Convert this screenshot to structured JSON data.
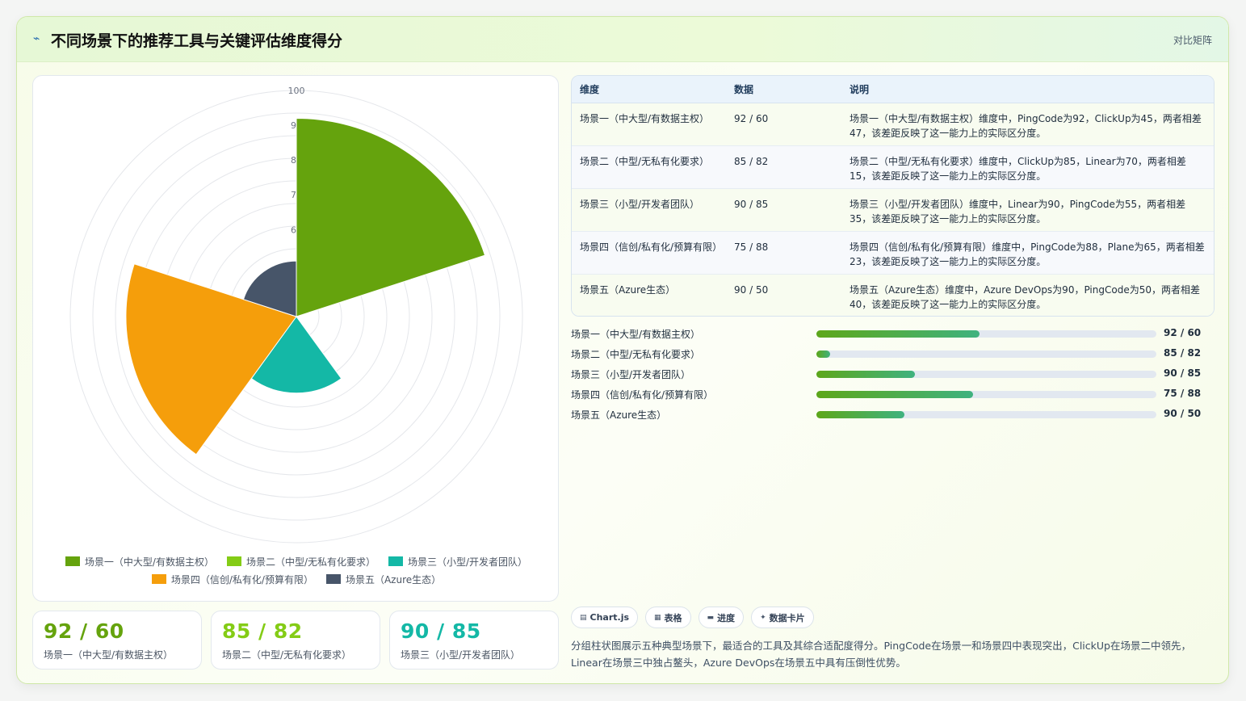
{
  "header": {
    "icon": "chart-line-icon",
    "title": "不同场景下的推荐工具与关键评估维度得分",
    "tag": "对比矩阵"
  },
  "colors": {
    "scenario1": "#65a30d",
    "scenario2": "#84cc16",
    "scenario3": "#14b8a6",
    "scenario4": "#f59e0b",
    "scenario5": "#475569",
    "kpi1": "#65a30d",
    "kpi2": "#84cc16",
    "kpi3": "#14b8a6"
  },
  "chart_data": {
    "type": "polarArea",
    "categories": [
      "场景一（中大型/有数据主权）",
      "场景二（中型/无私有化要求）",
      "场景三（小型/开发者团队）",
      "场景四（信创/私有化/预算有限）",
      "场景五（Azure生态）"
    ],
    "values": [
      92,
      35,
      57,
      84,
      51
    ],
    "r_ticks": [
      "100",
      "90",
      "80",
      "70",
      "60",
      "50"
    ],
    "r_range": [
      35,
      100
    ],
    "series_colors": [
      "#65a30d",
      "#84cc16",
      "#14b8a6",
      "#f59e0b",
      "#475569"
    ],
    "legend_position": "bottom",
    "grid": true
  },
  "table": {
    "headers": [
      "维度",
      "数据",
      "说明"
    ],
    "rows": [
      {
        "dim": "场景一（中大型/有数据主权）",
        "data": "92 / 60",
        "desc": "场景一（中大型/有数据主权）维度中，PingCode为92，ClickUp为45，两者相差47，该差距反映了这一能力上的实际区分度。"
      },
      {
        "dim": "场景二（中型/无私有化要求）",
        "data": "85 / 82",
        "desc": "场景二（中型/无私有化要求）维度中，ClickUp为85，Linear为70，两者相差15，该差距反映了这一能力上的实际区分度。"
      },
      {
        "dim": "场景三（小型/开发者团队）",
        "data": "90 / 85",
        "desc": "场景三（小型/开发者团队）维度中，Linear为90，PingCode为55，两者相差35，该差距反映了这一能力上的实际区分度。"
      },
      {
        "dim": "场景四（信创/私有化/预算有限）",
        "data": "75 / 88",
        "desc": "场景四（信创/私有化/预算有限）维度中，PingCode为88，Plane为65，两者相差23，该差距反映了这一能力上的实际区分度。"
      },
      {
        "dim": "场景五（Azure生态）",
        "data": "90 / 50",
        "desc": "场景五（Azure生态）维度中，Azure DevOps为90，PingCode为50，两者相差40，该差距反映了这一能力上的实际区分度。"
      }
    ]
  },
  "progress": [
    {
      "label": "场景一（中大型/有数据主权）",
      "value": "92 / 60",
      "fill": 0.48
    },
    {
      "label": "场景二（中型/无私有化要求）",
      "value": "85 / 82",
      "fill": 0.04
    },
    {
      "label": "场景三（小型/开发者团队）",
      "value": "90 / 85",
      "fill": 0.29
    },
    {
      "label": "场景四（信创/私有化/预算有限）",
      "value": "75 / 88",
      "fill": 0.46
    },
    {
      "label": "场景五（Azure生态）",
      "value": "90 / 50",
      "fill": 0.26
    }
  ],
  "kpis": [
    {
      "value": "92 / 60",
      "label": "场景一（中大型/有数据主权）"
    },
    {
      "value": "85 / 82",
      "label": "场景二（中型/无私有化要求）"
    },
    {
      "value": "90 / 85",
      "label": "场景三（小型/开发者团队）"
    }
  ],
  "chips": [
    {
      "icon": "chart-icon",
      "glyph": "▤",
      "label": "Chart.js"
    },
    {
      "icon": "table-icon",
      "glyph": "▦",
      "label": "表格"
    },
    {
      "icon": "progress-icon",
      "glyph": "▬",
      "label": "进度"
    },
    {
      "icon": "card-icon",
      "glyph": "✦",
      "label": "数据卡片"
    }
  ],
  "footnote": "分组柱状图展示五种典型场景下，最适合的工具及其综合适配度得分。PingCode在场景一和场景四中表现突出，ClickUp在场景二中领先，Linear在场景三中独占鳌头，Azure DevOps在场景五中具有压倒性优势。"
}
